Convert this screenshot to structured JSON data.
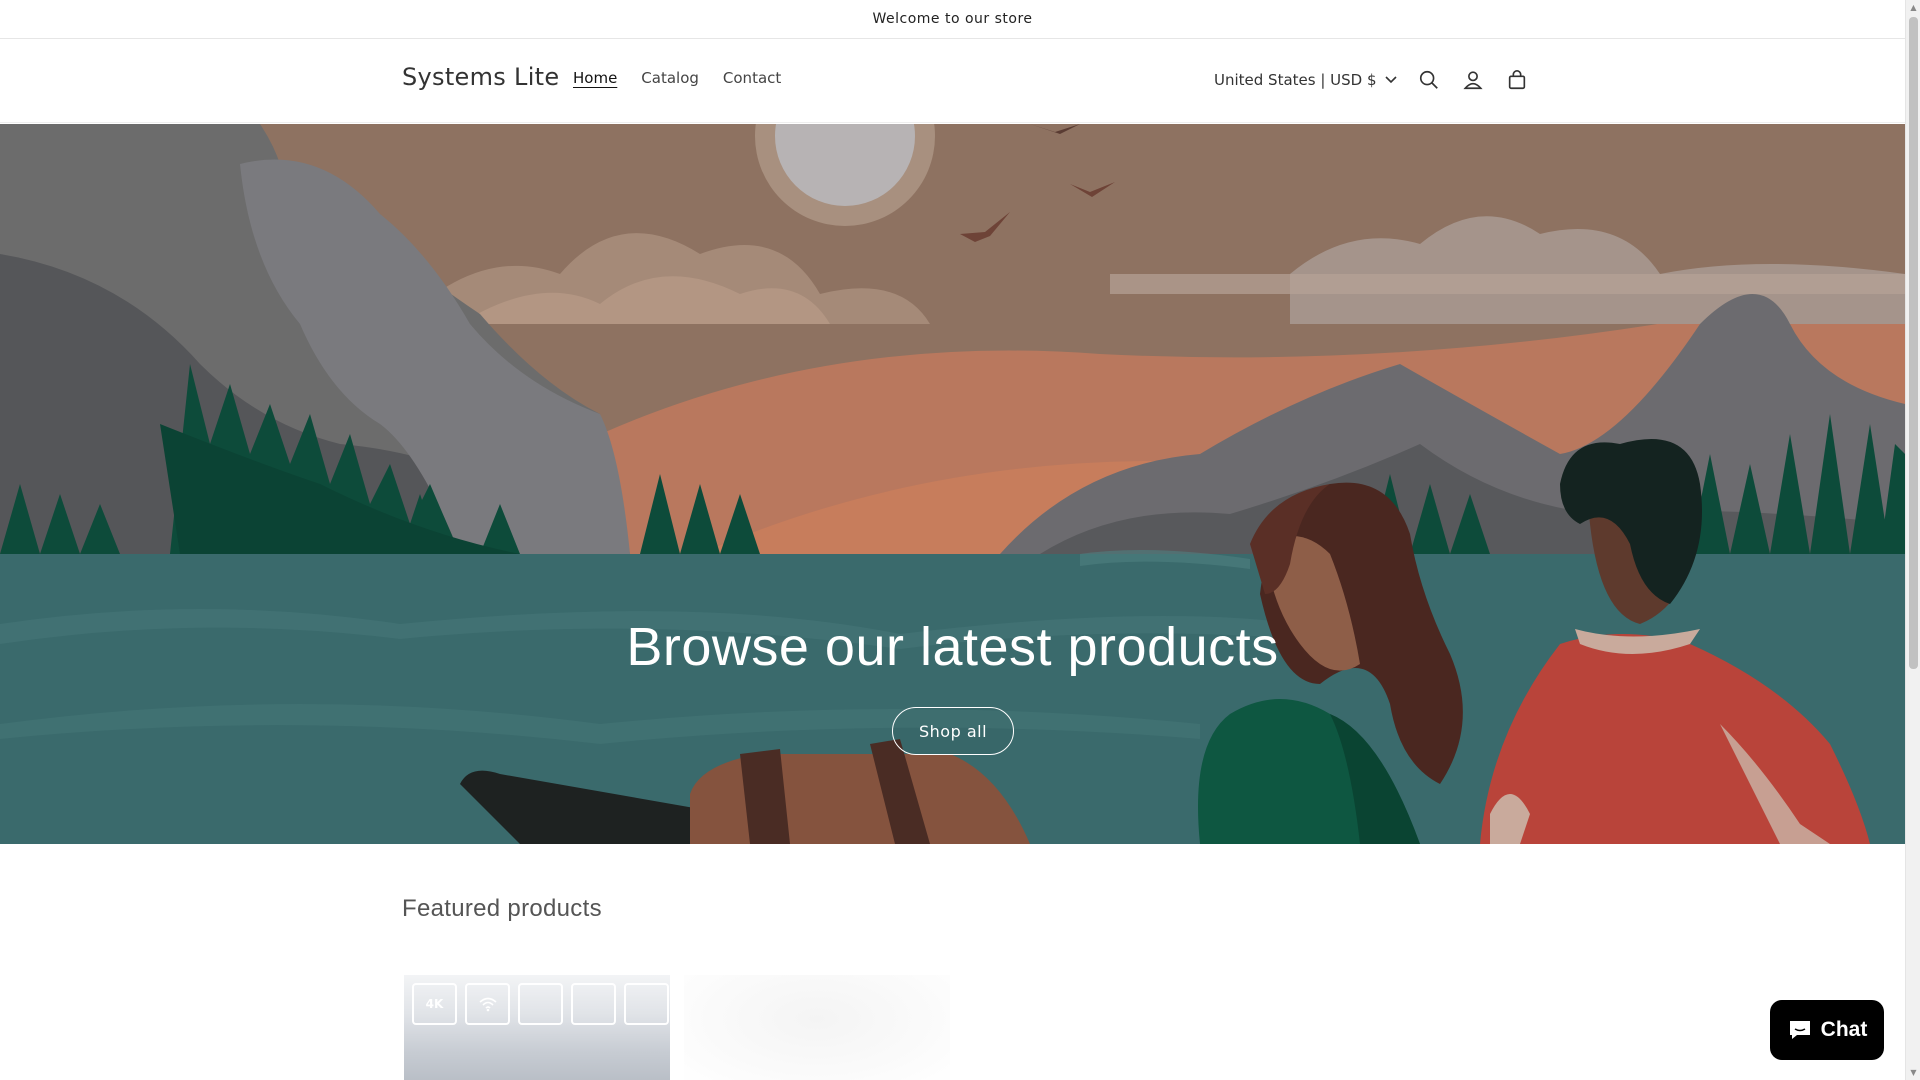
{
  "announcement": {
    "text": "Welcome to our store"
  },
  "header": {
    "logo": "Systems Lite",
    "nav": [
      {
        "label": "Home",
        "active": true
      },
      {
        "label": "Catalog",
        "active": false
      },
      {
        "label": "Contact",
        "active": false
      }
    ],
    "country_selector": "United States | USD $",
    "icons": [
      "search-icon",
      "account-icon",
      "cart-icon"
    ]
  },
  "hero": {
    "title": "Browse our latest products",
    "button_label": "Shop all"
  },
  "featured": {
    "title": "Featured products",
    "product1_badges": [
      "4K",
      "",
      "",
      "",
      ""
    ]
  },
  "chat": {
    "label": "Chat"
  },
  "colors": {
    "sky": "#8e7261",
    "water": "#3a6a6c",
    "forest": "#0d4b3a",
    "chat_bg": "#000000"
  }
}
